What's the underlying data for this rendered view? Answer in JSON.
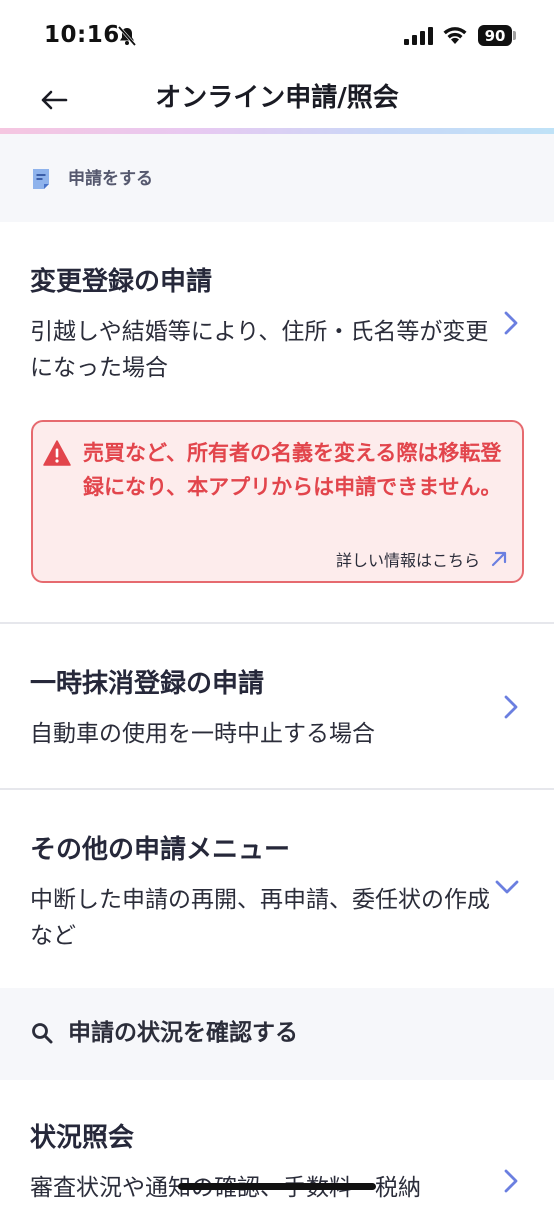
{
  "status_bar": {
    "time": "10:16",
    "battery": "90"
  },
  "nav": {
    "title": "オンライン申請/照会"
  },
  "apply_section": {
    "label": "申請をする"
  },
  "items": [
    {
      "title": "変更登録の申請",
      "description": "引越しや結婚等により、住所・氏名等が変更になった場合"
    },
    {
      "title": "一時抹消登録の申請",
      "description": "自動車の使用を一時中止する場合"
    },
    {
      "title": "その他の申請メニュー",
      "description": "中断した申請の再開、再申請、委任状の作成など"
    },
    {
      "title": "状況照会",
      "description": "審査状況や通知の確認、手数料・税納"
    }
  ],
  "warning": {
    "text": "売買など、所有者の名義を変える際は移転登録になり、本アプリからは申請できません。",
    "link_label": "詳しい情報はこちら"
  },
  "status_section": {
    "label": "申請の状況を確認する"
  },
  "colors": {
    "accent": "#6b7fe0",
    "warning": "#e2454c"
  }
}
